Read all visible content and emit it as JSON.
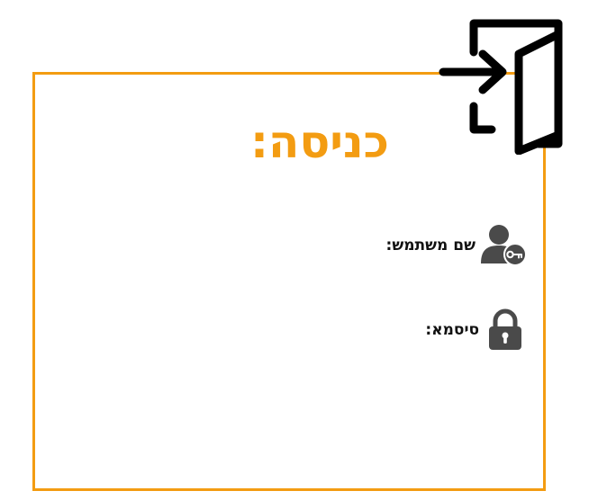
{
  "login": {
    "title": "כניסה:",
    "username_label": "שם משתמש:",
    "password_label": "סיסמא:"
  },
  "icons": {
    "entry": "door-enter-icon",
    "user": "user-key-icon",
    "lock": "padlock-icon"
  },
  "colors": {
    "accent": "#f39c12",
    "text": "#111111",
    "icon_dark": "#4a4a4a"
  }
}
